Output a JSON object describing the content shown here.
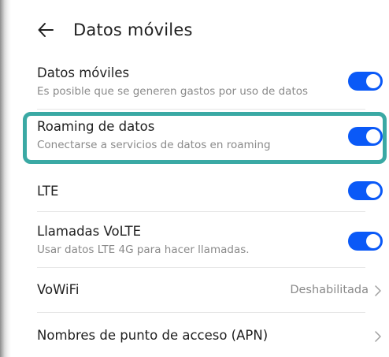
{
  "header": {
    "title": "Datos móviles"
  },
  "rows": [
    {
      "title": "Datos móviles",
      "subtitle": "Es posible que se generen gastos por uso de datos",
      "toggle_on": true
    },
    {
      "title": "Roaming de datos",
      "subtitle": "Conectarse a servicios de datos en roaming",
      "toggle_on": true,
      "highlighted": true
    },
    {
      "title": "LTE",
      "toggle_on": true
    },
    {
      "title": "Llamadas VoLTE",
      "subtitle": "Usar datos LTE 4G para hacer llamadas.",
      "toggle_on": true
    },
    {
      "title": "VoWiFi",
      "value": "Deshabilitada"
    },
    {
      "title": "Nombres de punto de acceso (APN)"
    }
  ],
  "colors": {
    "toggle_accent": "#0a59f7",
    "highlight_border": "#3aa9a4"
  },
  "icons": {
    "back": "arrow-left-icon",
    "chevron": "chevron-right-icon"
  }
}
